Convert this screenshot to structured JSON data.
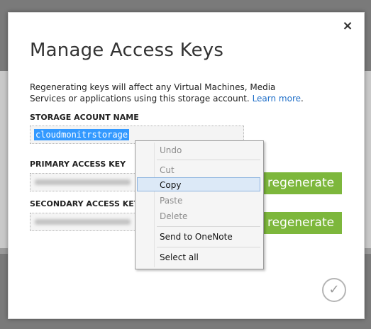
{
  "dialog": {
    "title": "Manage Access Keys",
    "description": "Regenerating keys will affect any Virtual Machines, Media Services or applications using this storage account.",
    "learn_more": "Learn more",
    "close_glyph": "×",
    "ok_glyph": "✓"
  },
  "fields": {
    "storage_name_label": "STORAGE ACOUNT NAME",
    "storage_name_value": "cloudmonitrstorage",
    "primary_label": "PRIMARY ACCESS KEY",
    "secondary_label": "SECONDARY ACCESS KEY"
  },
  "buttons": {
    "regenerate_primary": "regenerate",
    "regenerate_secondary": "regenerate"
  },
  "context_menu": {
    "undo": "Undo",
    "cut": "Cut",
    "copy": "Copy",
    "paste": "Paste",
    "delete": "Delete",
    "send_to_onenote": "Send to OneNote",
    "select_all": "Select all"
  },
  "colors": {
    "accent_green": "#7db73c",
    "link_blue": "#1e6ec8",
    "selection_blue": "#3399ff"
  }
}
